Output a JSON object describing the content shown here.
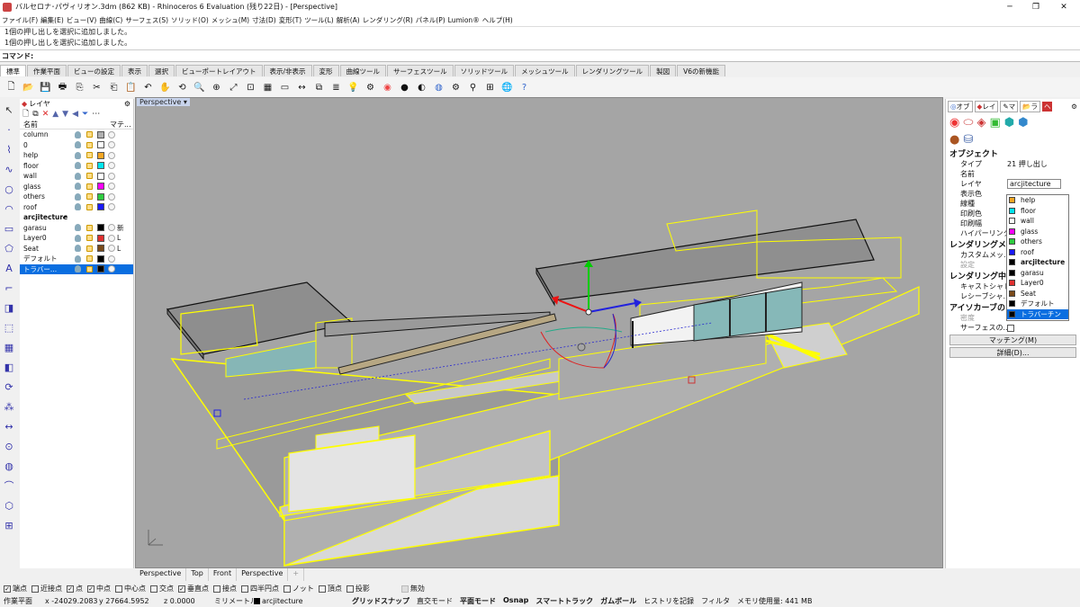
{
  "window": {
    "title": "バルセロナ･パヴィリオン.3dm (862 KB) - Rhinoceros 6 Evaluation (残り22日) - [Perspective]"
  },
  "menu": [
    "ファイル(F)",
    "編集(E)",
    "ビュー(V)",
    "曲線(C)",
    "サーフェス(S)",
    "ソリッド(O)",
    "メッシュ(M)",
    "寸法(D)",
    "変形(T)",
    "ツール(L)",
    "解析(A)",
    "レンダリング(R)",
    "パネル(P)",
    "Lumion®",
    "ヘルプ(H)"
  ],
  "history": [
    "1個の押し出しを選択に追加しました。",
    "1個の押し出しを選択に追加しました。"
  ],
  "command": {
    "label": "コマンド:"
  },
  "toolbar_tabs": [
    "標準",
    "作業平面",
    "ビューの設定",
    "表示",
    "選択",
    "ビューポートレイアウト",
    "表示/非表示",
    "変形",
    "曲線ツール",
    "サーフェスツール",
    "ソリッドツール",
    "メッシュツール",
    "レンダリングツール",
    "製図",
    "V6の新機能"
  ],
  "layers": {
    "title": "レイヤ",
    "col_name": "名前",
    "col_material": "マテ...",
    "rows": [
      {
        "name": "column",
        "color": "#b0b0b0",
        "current": false,
        "selected": false
      },
      {
        "name": "0",
        "color": "#ffffff",
        "current": false,
        "selected": false
      },
      {
        "name": "help",
        "color": "#f5a623",
        "current": false,
        "selected": false
      },
      {
        "name": "floor",
        "color": "#00e5ee",
        "current": false,
        "selected": false
      },
      {
        "name": "wall",
        "color": "#ffffff",
        "current": false,
        "selected": false
      },
      {
        "name": "glass",
        "color": "#ff00ff",
        "current": false,
        "selected": false
      },
      {
        "name": "others",
        "color": "#2ecc40",
        "current": false,
        "selected": false
      },
      {
        "name": "roof",
        "color": "#1a1aff",
        "current": false,
        "selected": false
      },
      {
        "name": "arcjitecture",
        "color": "#000000",
        "current": true,
        "selected": false
      },
      {
        "name": "garasu",
        "color": "#000000",
        "current": false,
        "selected": false,
        "extra": "新"
      },
      {
        "name": "Layer0",
        "color": "#e03030",
        "current": false,
        "selected": false,
        "extra": "L"
      },
      {
        "name": "Seat",
        "color": "#7a4a1a",
        "current": false,
        "selected": false,
        "extra": "L"
      },
      {
        "name": "デフォルト",
        "color": "#000000",
        "current": false,
        "selected": false
      },
      {
        "name": "トラバー...",
        "color": "#000000",
        "current": false,
        "selected": true
      }
    ]
  },
  "viewport": {
    "label": "Perspective",
    "tabs": [
      "Perspective",
      "Top",
      "Front",
      "Perspective"
    ]
  },
  "osnaps": [
    {
      "label": "端点",
      "checked": true
    },
    {
      "label": "近接点",
      "checked": false
    },
    {
      "label": "点",
      "checked": true
    },
    {
      "label": "中点",
      "checked": true
    },
    {
      "label": "中心点",
      "checked": false
    },
    {
      "label": "交点",
      "checked": false
    },
    {
      "label": "垂直点",
      "checked": true
    },
    {
      "label": "接点",
      "checked": false
    },
    {
      "label": "四半円点",
      "checked": false
    },
    {
      "label": "ノット",
      "checked": false
    },
    {
      "label": "頂点",
      "checked": false
    },
    {
      "label": "投影",
      "checked": false
    },
    {
      "label": "無効",
      "checked": false
    }
  ],
  "status": {
    "plane": "作業平面",
    "x": "x -24029.2083",
    "y": "y 27664.5952",
    "z": "z 0.0000",
    "unit": "ミリメートル",
    "layer": "arcjitecture",
    "modes": [
      "グリッドスナップ",
      "直交モード",
      "平面モード",
      "Osnap",
      "スマートトラック",
      "ガムボール",
      "ヒストリを記録",
      "フィルタ",
      "メモリ使用量: 441 MB"
    ]
  },
  "properties": {
    "tabs": [
      "オブ",
      "レイ",
      "マ",
      "ラ"
    ],
    "section_object": "オブジェクト",
    "rows": [
      {
        "k": "タイプ",
        "v": "21 押し出し"
      },
      {
        "k": "名前",
        "v": ""
      },
      {
        "k": "レイヤ",
        "v": "arcjitecture"
      },
      {
        "k": "表示色",
        "v": ""
      },
      {
        "k": "線種",
        "v": ""
      },
      {
        "k": "印刷色",
        "v": ""
      },
      {
        "k": "印刷幅",
        "v": ""
      },
      {
        "k": "ハイパーリンク",
        "v": ""
      }
    ],
    "section_render_mesh": "レンダリングメ",
    "custom_mesh": "カスタムメッ...",
    "setting": "設定",
    "section_render": "レンダリング中",
    "cast_shadow": "キャストシャド",
    "receive_shadow": "レシーブシャ...",
    "section_isocurve": "アイソカーブの",
    "density": "密度",
    "density_val": "1",
    "surface_iso": "サーフェスの...",
    "match_button": "マッチング(M)",
    "detail_button": "詳細(D)...",
    "dropdown": [
      {
        "name": "help",
        "color": "#f5a623"
      },
      {
        "name": "floor",
        "color": "#00e5ee"
      },
      {
        "name": "wall",
        "color": "#ffffff"
      },
      {
        "name": "glass",
        "color": "#ff00ff"
      },
      {
        "name": "others",
        "color": "#2ecc40"
      },
      {
        "name": "roof",
        "color": "#1a1aff"
      },
      {
        "name": "arcjitecture",
        "color": "#000000",
        "bold": true
      },
      {
        "name": "garasu",
        "color": "#000000"
      },
      {
        "name": "Layer0",
        "color": "#e03030"
      },
      {
        "name": "Seat",
        "color": "#7a4a1a"
      },
      {
        "name": "デフォルト",
        "color": "#000000"
      },
      {
        "name": "トラバーチン",
        "color": "#000000",
        "selected": true
      }
    ]
  }
}
